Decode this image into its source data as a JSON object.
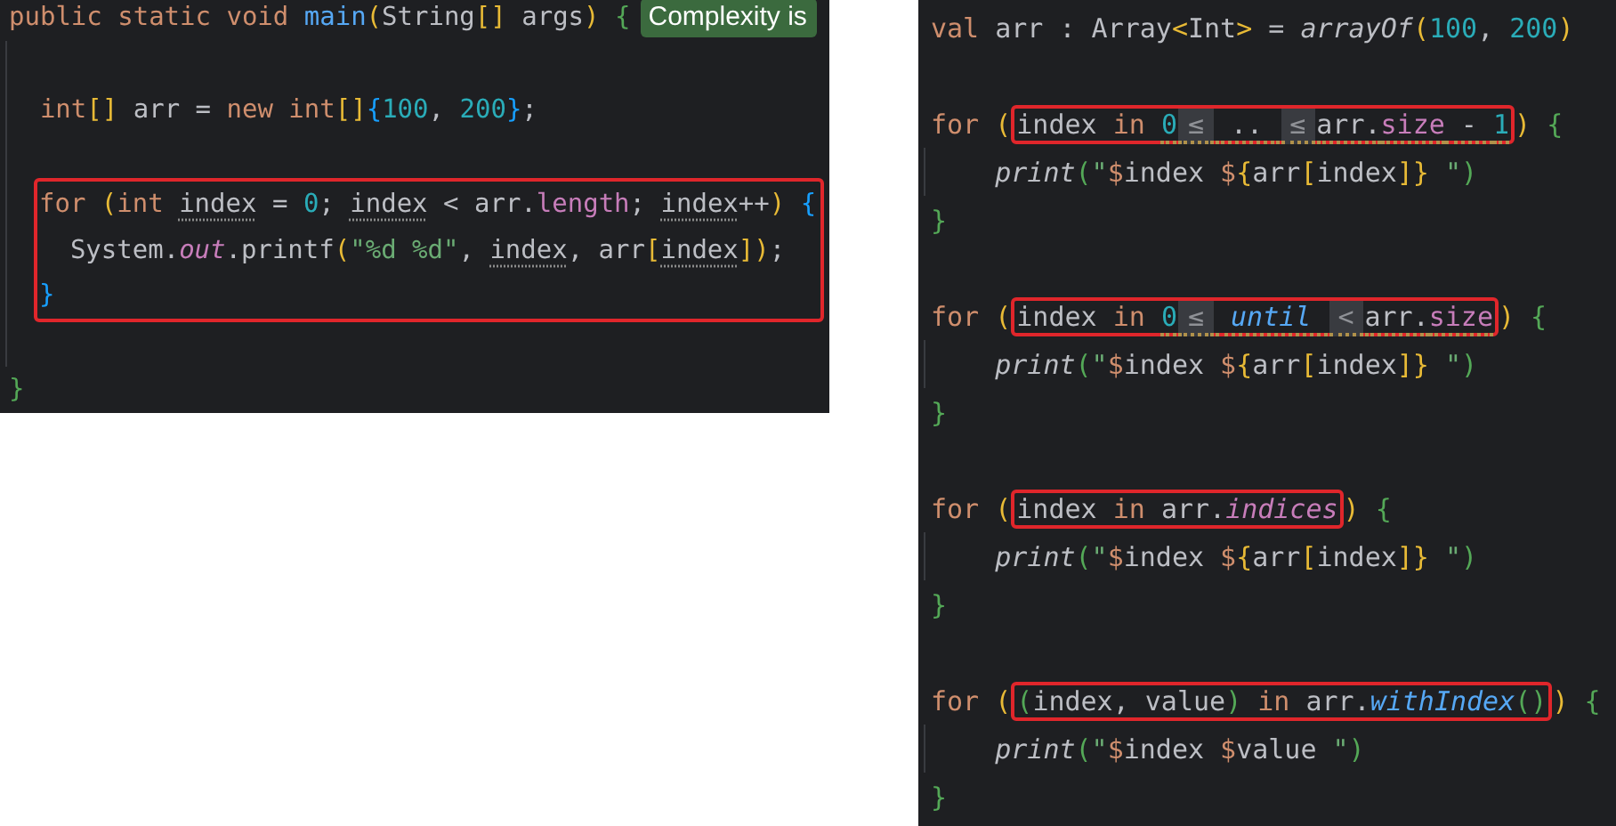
{
  "java_panel": {
    "lines": [
      {
        "segments": [
          {
            "kind": "code",
            "tokens": [
              {
                "kind": "keyword",
                "text": "public static void "
              },
              {
                "kind": "function",
                "text": "main"
              },
              {
                "kind": "bracket",
                "text": "("
              },
              {
                "kind": "plain",
                "text": "String"
              },
              {
                "kind": "bracket",
                "text": "[]"
              },
              {
                "kind": "plain",
                "text": " args"
              },
              {
                "kind": "bracket",
                "text": ")"
              },
              {
                "kind": "brace-green",
                "text": " {"
              }
            ]
          },
          {
            "kind": "badge",
            "text": "Complexity is"
          }
        ]
      },
      {
        "guide": true
      },
      {
        "guide": true,
        "indented": true,
        "segments": [
          {
            "kind": "code",
            "tokens": [
              {
                "kind": "keyword",
                "text": "int"
              },
              {
                "kind": "bracket",
                "text": "[]"
              },
              {
                "kind": "plain",
                "text": " arr = "
              },
              {
                "kind": "keyword",
                "text": "new "
              },
              {
                "kind": "keyword",
                "text": "int"
              },
              {
                "kind": "bracket",
                "text": "[]"
              },
              {
                "kind": "brace-blue",
                "text": "{"
              },
              {
                "kind": "number",
                "text": "100"
              },
              {
                "kind": "plain",
                "text": ", "
              },
              {
                "kind": "number",
                "text": "200"
              },
              {
                "kind": "brace-blue",
                "text": "}"
              },
              {
                "kind": "plain",
                "text": ";"
              }
            ]
          }
        ]
      },
      {
        "guide": true
      },
      {
        "guide": true,
        "kind": "box-block",
        "lines": [
          {
            "segments": [
              {
                "kind": "code",
                "tokens": [
                  {
                    "kind": "keyword",
                    "text": "for "
                  },
                  {
                    "kind": "bracket",
                    "text": "("
                  },
                  {
                    "kind": "keyword",
                    "text": "int "
                  },
                  {
                    "kind": "plain",
                    "text": "index",
                    "underline": true
                  },
                  {
                    "kind": "plain",
                    "text": " = "
                  },
                  {
                    "kind": "number",
                    "text": "0"
                  },
                  {
                    "kind": "plain",
                    "text": "; "
                  },
                  {
                    "kind": "plain",
                    "text": "index",
                    "underline": true
                  },
                  {
                    "kind": "plain",
                    "text": " < arr."
                  },
                  {
                    "kind": "field",
                    "text": "length"
                  },
                  {
                    "kind": "plain",
                    "text": "; "
                  },
                  {
                    "kind": "plain",
                    "text": "index",
                    "underline": true
                  },
                  {
                    "kind": "plain",
                    "text": "++"
                  },
                  {
                    "kind": "bracket",
                    "text": ")"
                  },
                  {
                    "kind": "brace-blue",
                    "text": " {"
                  }
                ]
              }
            ]
          },
          {
            "indented": true,
            "segments": [
              {
                "kind": "code",
                "tokens": [
                  {
                    "kind": "plain",
                    "text": "System."
                  },
                  {
                    "kind": "field",
                    "text": "out",
                    "italic": true
                  },
                  {
                    "kind": "plain",
                    "text": ".printf"
                  },
                  {
                    "kind": "bracket",
                    "text": "("
                  },
                  {
                    "kind": "string",
                    "text": "\"%d %d\""
                  },
                  {
                    "kind": "plain",
                    "text": ", "
                  },
                  {
                    "kind": "plain",
                    "text": "index",
                    "underline": true
                  },
                  {
                    "kind": "plain",
                    "text": ", arr"
                  },
                  {
                    "kind": "bracket",
                    "text": "["
                  },
                  {
                    "kind": "plain",
                    "text": "index",
                    "underline": true
                  },
                  {
                    "kind": "bracket",
                    "text": "]"
                  },
                  {
                    "kind": "bracket",
                    "text": ")"
                  },
                  {
                    "kind": "plain",
                    "text": ";"
                  }
                ]
              }
            ]
          },
          {
            "segments": [
              {
                "kind": "code",
                "tokens": [
                  {
                    "kind": "brace-blue",
                    "text": "}"
                  }
                ]
              }
            ]
          }
        ]
      },
      {
        "guide": true
      },
      {
        "segments": [
          {
            "kind": "code",
            "tokens": [
              {
                "kind": "brace-green",
                "text": "}"
              }
            ]
          }
        ]
      }
    ]
  },
  "kotlin_panel": {
    "lines": [
      {
        "segments": [
          {
            "kind": "code",
            "tokens": [
              {
                "kind": "keyword",
                "text": "val "
              },
              {
                "kind": "plain",
                "text": "arr : Array"
              },
              {
                "kind": "bracket",
                "text": "<"
              },
              {
                "kind": "plain",
                "text": "Int"
              },
              {
                "kind": "bracket",
                "text": ">"
              },
              {
                "kind": "plain",
                "text": " = "
              },
              {
                "kind": "plain",
                "text": "arrayOf",
                "italic": true
              },
              {
                "kind": "bracket",
                "text": "("
              },
              {
                "kind": "number",
                "text": "100"
              },
              {
                "kind": "plain",
                "text": ", "
              },
              {
                "kind": "number",
                "text": "200"
              },
              {
                "kind": "bracket",
                "text": ")"
              }
            ]
          }
        ]
      },
      {
        "guide": false
      },
      {
        "segments": [
          {
            "kind": "code",
            "tokens": [
              {
                "kind": "keyword",
                "text": "for "
              },
              {
                "kind": "bracket",
                "text": "("
              }
            ]
          },
          {
            "kind": "box",
            "tokens": [
              {
                "kind": "plain",
                "text": "index "
              },
              {
                "kind": "keyword",
                "text": "in "
              },
              {
                "kind": "number",
                "text": "0",
                "warning": true
              },
              {
                "kind": "hint",
                "text": "≤",
                "warning": true
              },
              {
                "kind": "plain",
                "text": " .. ",
                "warning": true
              },
              {
                "kind": "hint",
                "text": "≤",
                "warning": true
              },
              {
                "kind": "plain",
                "text": "arr.",
                "warning": true
              },
              {
                "kind": "field",
                "text": "size",
                "warning": true
              },
              {
                "kind": "plain",
                "text": " - ",
                "warning": true
              },
              {
                "kind": "number",
                "text": "1",
                "warning": true
              }
            ]
          },
          {
            "kind": "code",
            "tokens": [
              {
                "kind": "bracket",
                "text": ")"
              },
              {
                "kind": "brace-green",
                "text": " {"
              }
            ]
          }
        ]
      },
      {
        "guide": true,
        "indented": true,
        "segments": [
          {
            "kind": "code",
            "tokens": [
              {
                "kind": "plain",
                "text": "print",
                "italic": true
              },
              {
                "kind": "brace-green",
                "text": "("
              },
              {
                "kind": "string",
                "text": "\""
              },
              {
                "kind": "keyword",
                "text": "$"
              },
              {
                "kind": "plain",
                "text": "index "
              },
              {
                "kind": "keyword",
                "text": "$"
              },
              {
                "kind": "bracket",
                "text": "{"
              },
              {
                "kind": "plain",
                "text": "arr"
              },
              {
                "kind": "bracket",
                "text": "["
              },
              {
                "kind": "plain",
                "text": "index"
              },
              {
                "kind": "bracket",
                "text": "]"
              },
              {
                "kind": "bracket",
                "text": "}"
              },
              {
                "kind": "string",
                "text": " \""
              },
              {
                "kind": "brace-green",
                "text": ")"
              }
            ]
          }
        ]
      },
      {
        "segments": [
          {
            "kind": "code",
            "tokens": [
              {
                "kind": "brace-green",
                "text": "}"
              }
            ]
          }
        ]
      },
      {
        "guide": false
      },
      {
        "segments": [
          {
            "kind": "code",
            "tokens": [
              {
                "kind": "keyword",
                "text": "for "
              },
              {
                "kind": "bracket",
                "text": "("
              }
            ]
          },
          {
            "kind": "box",
            "tokens": [
              {
                "kind": "plain",
                "text": "index "
              },
              {
                "kind": "keyword",
                "text": "in "
              },
              {
                "kind": "number",
                "text": "0",
                "warning": true
              },
              {
                "kind": "hint",
                "text": "≤",
                "warning": true
              },
              {
                "kind": "function",
                "text": " until ",
                "italic": true,
                "warning": true
              },
              {
                "kind": "hint",
                "text": "<",
                "warning": true
              },
              {
                "kind": "plain",
                "text": "arr.",
                "warning": true
              },
              {
                "kind": "field",
                "text": "size",
                "warning": true
              }
            ]
          },
          {
            "kind": "code",
            "tokens": [
              {
                "kind": "bracket",
                "text": ")"
              },
              {
                "kind": "brace-green",
                "text": " {"
              }
            ]
          }
        ]
      },
      {
        "guide": true,
        "indented": true,
        "segments": [
          {
            "kind": "code",
            "tokens": [
              {
                "kind": "plain",
                "text": "print",
                "italic": true
              },
              {
                "kind": "brace-green",
                "text": "("
              },
              {
                "kind": "string",
                "text": "\""
              },
              {
                "kind": "keyword",
                "text": "$"
              },
              {
                "kind": "plain",
                "text": "index "
              },
              {
                "kind": "keyword",
                "text": "$"
              },
              {
                "kind": "bracket",
                "text": "{"
              },
              {
                "kind": "plain",
                "text": "arr"
              },
              {
                "kind": "bracket",
                "text": "["
              },
              {
                "kind": "plain",
                "text": "index"
              },
              {
                "kind": "bracket",
                "text": "]"
              },
              {
                "kind": "bracket",
                "text": "}"
              },
              {
                "kind": "string",
                "text": " \""
              },
              {
                "kind": "brace-green",
                "text": ")"
              }
            ]
          }
        ]
      },
      {
        "segments": [
          {
            "kind": "code",
            "tokens": [
              {
                "kind": "brace-green",
                "text": "}"
              }
            ]
          }
        ]
      },
      {
        "guide": false
      },
      {
        "segments": [
          {
            "kind": "code",
            "tokens": [
              {
                "kind": "keyword",
                "text": "for "
              },
              {
                "kind": "bracket",
                "text": "("
              }
            ]
          },
          {
            "kind": "box",
            "tokens": [
              {
                "kind": "plain",
                "text": "index "
              },
              {
                "kind": "keyword",
                "text": "in "
              },
              {
                "kind": "plain",
                "text": "arr."
              },
              {
                "kind": "field",
                "text": "indices",
                "italic": true
              }
            ]
          },
          {
            "kind": "code",
            "tokens": [
              {
                "kind": "bracket",
                "text": ")"
              },
              {
                "kind": "brace-green",
                "text": " {"
              }
            ]
          }
        ]
      },
      {
        "guide": true,
        "indented": true,
        "segments": [
          {
            "kind": "code",
            "tokens": [
              {
                "kind": "plain",
                "text": "print",
                "italic": true
              },
              {
                "kind": "brace-green",
                "text": "("
              },
              {
                "kind": "string",
                "text": "\""
              },
              {
                "kind": "keyword",
                "text": "$"
              },
              {
                "kind": "plain",
                "text": "index "
              },
              {
                "kind": "keyword",
                "text": "$"
              },
              {
                "kind": "bracket",
                "text": "{"
              },
              {
                "kind": "plain",
                "text": "arr"
              },
              {
                "kind": "bracket",
                "text": "["
              },
              {
                "kind": "plain",
                "text": "index"
              },
              {
                "kind": "bracket",
                "text": "]"
              },
              {
                "kind": "bracket",
                "text": "}"
              },
              {
                "kind": "string",
                "text": " \""
              },
              {
                "kind": "brace-green",
                "text": ")"
              }
            ]
          }
        ]
      },
      {
        "segments": [
          {
            "kind": "code",
            "tokens": [
              {
                "kind": "brace-green",
                "text": "}"
              }
            ]
          }
        ]
      },
      {
        "guide": false
      },
      {
        "segments": [
          {
            "kind": "code",
            "tokens": [
              {
                "kind": "keyword",
                "text": "for "
              },
              {
                "kind": "bracket",
                "text": "("
              }
            ]
          },
          {
            "kind": "box",
            "tokens": [
              {
                "kind": "brace-green",
                "text": "("
              },
              {
                "kind": "plain",
                "text": "index, value"
              },
              {
                "kind": "brace-green",
                "text": ")"
              },
              {
                "kind": "keyword",
                "text": " in "
              },
              {
                "kind": "plain",
                "text": "arr."
              },
              {
                "kind": "function",
                "text": "withIndex",
                "italic": true
              },
              {
                "kind": "brace-green",
                "text": "()"
              }
            ]
          },
          {
            "kind": "code",
            "tokens": [
              {
                "kind": "bracket",
                "text": ")"
              },
              {
                "kind": "brace-green",
                "text": " {"
              }
            ]
          }
        ]
      },
      {
        "guide": true,
        "indented": true,
        "segments": [
          {
            "kind": "code",
            "tokens": [
              {
                "kind": "plain",
                "text": "print",
                "italic": true
              },
              {
                "kind": "brace-green",
                "text": "("
              },
              {
                "kind": "string",
                "text": "\""
              },
              {
                "kind": "keyword",
                "text": "$"
              },
              {
                "kind": "plain",
                "text": "index "
              },
              {
                "kind": "keyword",
                "text": "$"
              },
              {
                "kind": "plain",
                "text": "value"
              },
              {
                "kind": "string",
                "text": " \""
              },
              {
                "kind": "brace-green",
                "text": ")"
              }
            ]
          }
        ]
      },
      {
        "segments": [
          {
            "kind": "code",
            "tokens": [
              {
                "kind": "brace-green",
                "text": "}"
              }
            ]
          }
        ]
      }
    ]
  }
}
